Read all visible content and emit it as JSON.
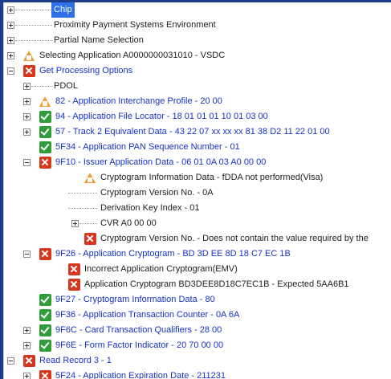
{
  "tree": {
    "items": [
      {
        "label": "Chip",
        "icon": "",
        "expander": "plus",
        "selected": true
      },
      {
        "label": "Proximity Payment Systems Environment",
        "icon": "",
        "expander": "plus"
      },
      {
        "label": "Partial Name Selection",
        "icon": "",
        "expander": "plus"
      },
      {
        "label": "Selecting Application A0000000031010 - VSDC",
        "icon": "warning-icon",
        "expander": "plus"
      },
      {
        "label": "Get Processing Options",
        "icon": "error-icon",
        "expander": "minus"
      },
      {
        "label": "PDOL",
        "icon": "",
        "expander": "plus"
      },
      {
        "label": "82 - Application Interchange Profile - 20 00",
        "icon": "warning-icon",
        "expander": "plus"
      },
      {
        "label": "94 - Application File Locator - 18 01 01 01 10 01 03 00",
        "icon": "check-icon",
        "expander": "plus"
      },
      {
        "label": "57 - Track 2 Equivalent Data - 43 22 07 xx xx xx 81 38 D2 11 22 01 00",
        "icon": "check-icon",
        "expander": "plus"
      },
      {
        "label": "5F34 - Application PAN Sequence Number - 01",
        "icon": "check-icon",
        "expander": ""
      },
      {
        "label": "9F10 - Issuer Application Data - 06 01 0A 03 A0 00 00",
        "icon": "error-icon",
        "expander": "minus"
      },
      {
        "label": "Cryptogram Information Data - fDDA not performed(Visa)",
        "icon": "warning-icon",
        "expander": ""
      },
      {
        "label": "Cryptogram Version No. - 0A",
        "icon": "",
        "expander": ""
      },
      {
        "label": "Derivation Key Index - 01",
        "icon": "",
        "expander": ""
      },
      {
        "label": "CVR A0 00 00",
        "icon": "",
        "expander": "plus"
      },
      {
        "label": "Cryptogram Version No. - Does not contain the value required by the",
        "icon": "error-icon",
        "expander": ""
      },
      {
        "label": "9F26 - Application Cryptogram - BD 3D EE 8D 18 C7 EC 1B",
        "icon": "error-icon",
        "expander": "minus"
      },
      {
        "label": "Incorrect Application Cryptogram(EMV)",
        "icon": "error-icon",
        "expander": ""
      },
      {
        "label": "Application Cryptogram BD3DEE8D18C7EC1B - Expected 5AA6B1",
        "icon": "error-icon",
        "expander": ""
      },
      {
        "label": "9F27 - Cryptogram Information Data - 80",
        "icon": "check-icon",
        "expander": ""
      },
      {
        "label": "9F36 - Application Transaction Counter - 0A 6A",
        "icon": "check-icon",
        "expander": ""
      },
      {
        "label": "9F6C - Card Transaction Qualifiers - 28 00",
        "icon": "check-icon",
        "expander": "plus"
      },
      {
        "label": "9F6E - Form Factor Indicator - 20 70 00 00",
        "icon": "check-icon",
        "expander": "plus"
      },
      {
        "label": "Read Record 3 - 1",
        "icon": "error-icon",
        "expander": "minus"
      },
      {
        "label": "5F24 - Application Expiration Date - 211231",
        "icon": "error-icon",
        "expander": "plus"
      }
    ]
  },
  "colors": {
    "frame": "#1f3c8a",
    "link_text": "#1532c9",
    "selection": "#2f6fe8",
    "ok": "#2f9e3a",
    "error": "#d6371f",
    "warning": "#f29a2e"
  }
}
